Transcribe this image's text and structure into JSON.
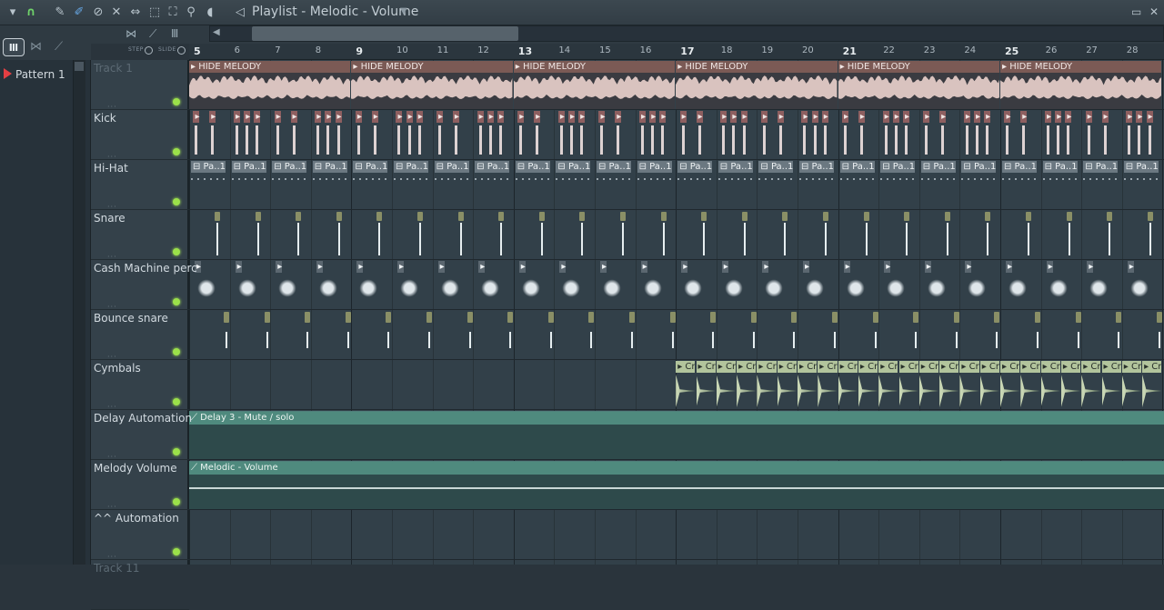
{
  "title": "Playlist - Melodic - Volume",
  "toolbar": {
    "icons": [
      "menu-arrow-icon",
      "magnet-icon",
      "pencil-icon",
      "brush-icon",
      "mute-icon",
      "slip-icon",
      "select-icon",
      "zoom-icon",
      "playback-icon",
      "speaker-icon"
    ],
    "step_label": "STEP",
    "slide_label": "SLIDE"
  },
  "left_panel": {
    "pattern": "Pattern 1"
  },
  "ruler": {
    "bars": [
      "5",
      "6",
      "7",
      "8",
      "9",
      "10",
      "11",
      "12",
      "13",
      "14",
      "15",
      "16",
      "17",
      "18",
      "19",
      "20",
      "21",
      "22",
      "23",
      "24",
      "25",
      "26",
      "27",
      "28"
    ],
    "major": [
      "5",
      "9",
      "13",
      "17",
      "21",
      "25"
    ]
  },
  "tracks": [
    {
      "name": "Track 1",
      "dim": true
    },
    {
      "name": "Kick"
    },
    {
      "name": "Hi-Hat"
    },
    {
      "name": "Snare"
    },
    {
      "name": "Cash Machine perc"
    },
    {
      "name": "Bounce snare"
    },
    {
      "name": "Cymbals"
    },
    {
      "name": "Delay Automation"
    },
    {
      "name": "Melody Volume"
    },
    {
      "name": "^^ Automation"
    },
    {
      "name": "Track 11",
      "dim": true
    }
  ],
  "clips": {
    "melody_label": "HIDE MELODY",
    "hat_label": "Pa..1",
    "cymbal_label": "Cr",
    "delay_label": "Delay 3 - Mute / solo",
    "volume_label": "Melodic - Volume"
  },
  "colors": {
    "melody_header": "#7b5a55",
    "automation": "#4f8a7e",
    "cymbals": "#b2c49c",
    "led": "#9be04a"
  }
}
